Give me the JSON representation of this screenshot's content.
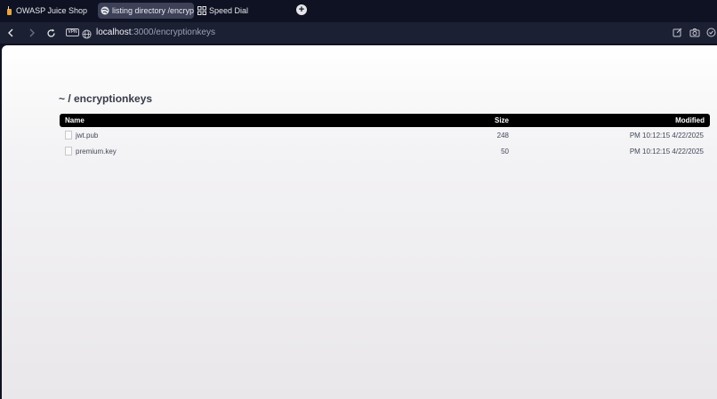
{
  "browser": {
    "tabs": [
      {
        "label": "OWASP Juice Shop",
        "icon": "juice-shop-icon"
      },
      {
        "label": "listing directory /encryp",
        "icon": "globe-icon"
      },
      {
        "label": "Speed Dial",
        "icon": "grid-icon"
      }
    ],
    "new_tab_label": "+",
    "vpn_label": "VPN",
    "url": {
      "host": "localhost",
      "path": ":3000/encryptionkeys"
    }
  },
  "page": {
    "heading": "~ / encryptionkeys",
    "columns": {
      "name": "Name",
      "size": "Size",
      "modified": "Modified"
    },
    "files": [
      {
        "name": "jwt.pub",
        "size": "248",
        "modified": "PM 10:12:15 4/22/2025"
      },
      {
        "name": "premium.key",
        "size": "50",
        "modified": "PM 10:12:15 4/22/2025"
      }
    ]
  }
}
